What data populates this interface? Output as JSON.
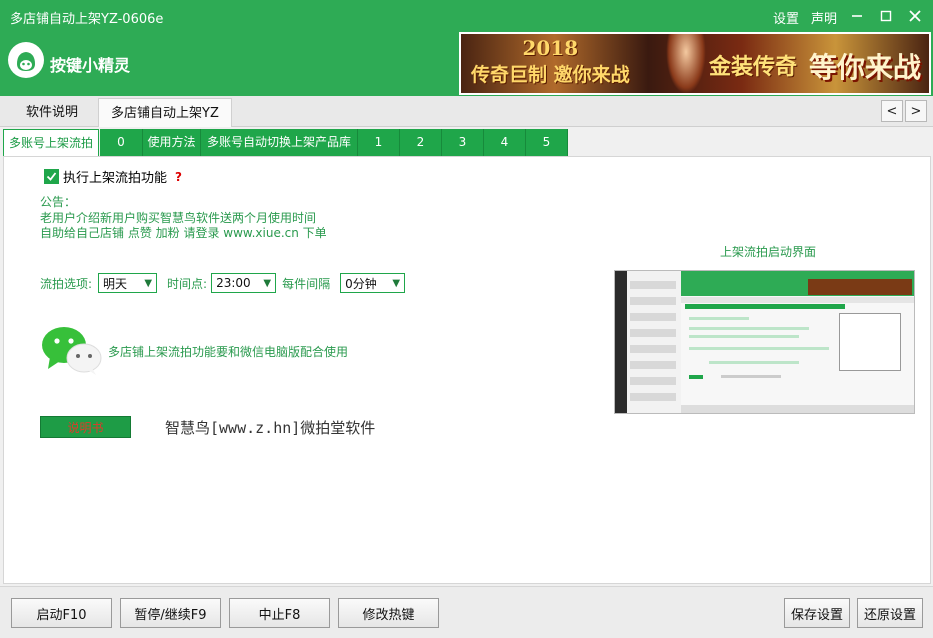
{
  "window": {
    "title": "多店铺自动上架YZ-0606e",
    "menu": [
      "设置",
      "声明"
    ],
    "controls": [
      "minimize-icon",
      "maximize-icon",
      "close-icon"
    ]
  },
  "header": {
    "logo_text": "按键小精灵",
    "banner": {
      "year": "2018",
      "line1": "传奇巨制 邀你来战",
      "brand": "金装传奇",
      "slogan": "等你来战"
    }
  },
  "main_tabs": [
    "软件说明",
    "多店铺自动上架YZ"
  ],
  "active_main_tab": 1,
  "nav": {
    "prev": "<",
    "next": ">"
  },
  "sub_tabs": [
    "多账号上架流拍",
    "0",
    "使用方法",
    "多账号自动切换上架产品库",
    "1",
    "2",
    "3",
    "4",
    "5"
  ],
  "active_sub_tab": 0,
  "content": {
    "enable_checkbox": {
      "label": "执行上架流拍功能",
      "checked": true,
      "help": "?"
    },
    "notice_title": "公告：",
    "notice_lines": [
      "老用户介绍新用户购买智慧鸟软件送两个月使用时间",
      "自助给自己店铺 点赞 加粉 请登录 www.xiue.cn 下单"
    ],
    "options": {
      "flow_label": "流拍选项:",
      "flow_value": "明天",
      "time_label": "时间点:",
      "time_value": "23:00",
      "interval_label": "每件间隔",
      "interval_value": "0分钟"
    },
    "wechat_note": "多店铺上架流拍功能要和微信电脑版配合使用",
    "manual_button": "说明书",
    "brand_text": "智慧鸟[www.z.hn]微拍堂软件",
    "screenshot_caption": "上架流拍启动界面"
  },
  "bottom_buttons": {
    "start": "启动F10",
    "pause": "暂停/继续F9",
    "stop": "中止F8",
    "hotkey": "修改热键",
    "save": "保存设置",
    "restore": "还原设置"
  },
  "colors": {
    "brand_green": "#2eab55",
    "tab_green": "#1fa64a",
    "text_green": "#2a9a4e",
    "alert_red": "#d00000"
  }
}
